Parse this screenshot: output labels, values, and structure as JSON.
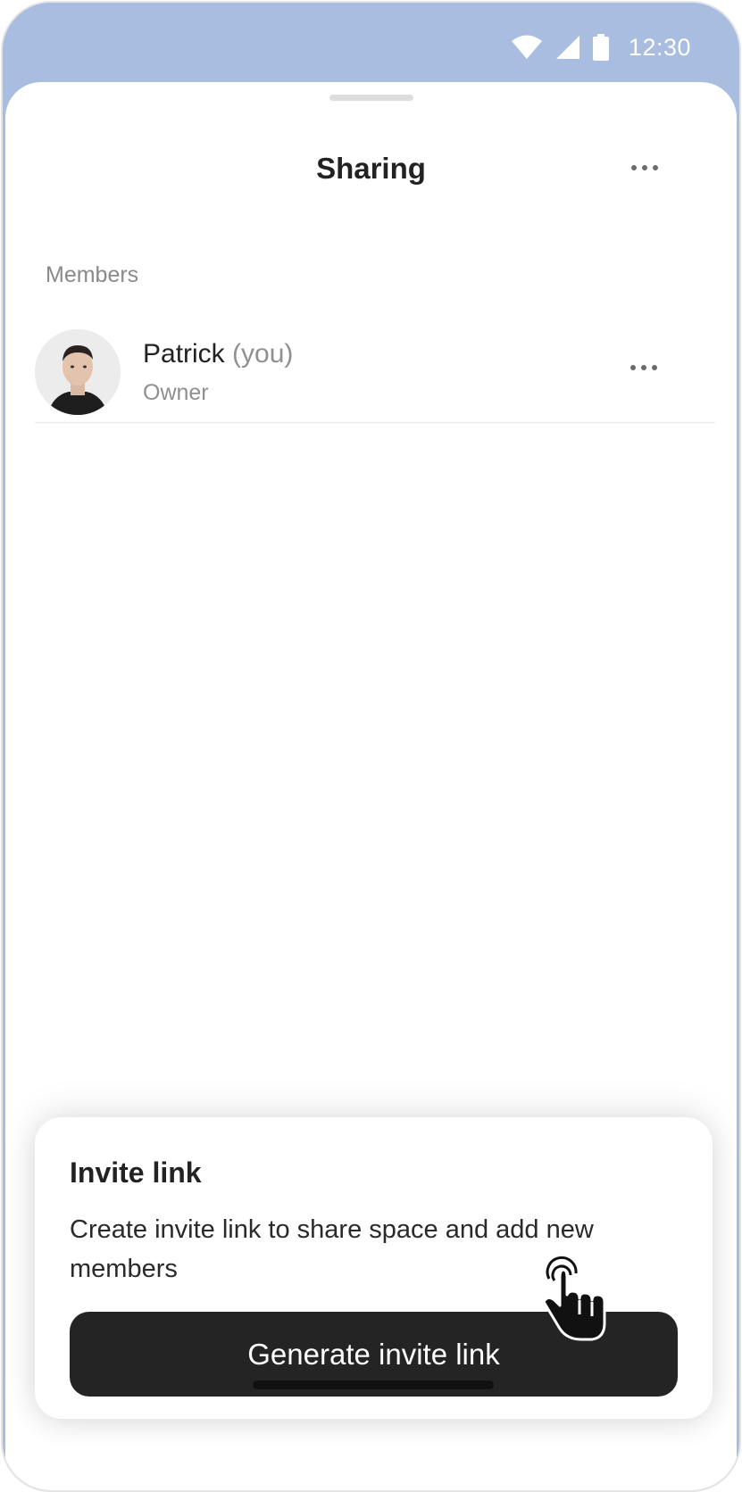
{
  "status_bar": {
    "time": "12:30",
    "icons": [
      "wifi-icon",
      "cellular-signal-icon",
      "battery-icon"
    ],
    "background_color": "#a8bde0"
  },
  "header": {
    "title": "Sharing",
    "more_icon": "more-horizontal-icon"
  },
  "members_section": {
    "label": "Members",
    "members": [
      {
        "name": "Patrick",
        "suffix": "(you)",
        "role": "Owner",
        "avatar": "avatar-photo",
        "more_icon": "more-horizontal-icon"
      }
    ]
  },
  "invite_card": {
    "title": "Invite link",
    "description": "Create invite link to share space and add new members",
    "button_label": "Generate invite link",
    "button_color": "#242424"
  }
}
